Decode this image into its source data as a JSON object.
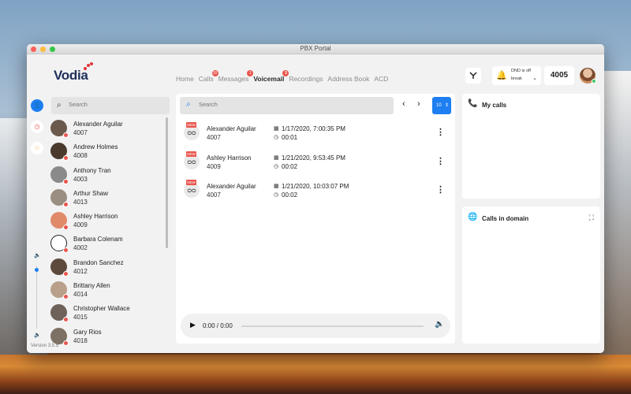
{
  "window": {
    "title": "PBX Portal"
  },
  "brand": {
    "logo_text": "Vodia",
    "logo_color": "#1f2e5a",
    "dot_color": "#e0353b"
  },
  "nav": {
    "items": [
      {
        "label": "Home",
        "badge": ""
      },
      {
        "label": "Calls",
        "badge": "10"
      },
      {
        "label": "Messages",
        "badge": "1"
      },
      {
        "label": "Voicemail",
        "badge": "3",
        "active": true
      },
      {
        "label": "Recordings",
        "badge": ""
      },
      {
        "label": "Address Book",
        "badge": ""
      },
      {
        "label": "ACD",
        "badge": ""
      }
    ]
  },
  "header": {
    "transfer_icon": "call-transfer-icon",
    "dnd_status": "DND is off",
    "dnd_option": "break",
    "extension": "4005",
    "bell_icon": "bell-icon"
  },
  "contacts": {
    "search_placeholder": "Search",
    "items": [
      {
        "name": "Alexander Aguilar",
        "ext": "4007"
      },
      {
        "name": "Andrew Holmes",
        "ext": "4008"
      },
      {
        "name": "Anthony Tran",
        "ext": "4003"
      },
      {
        "name": "Arthur Shaw",
        "ext": "4013"
      },
      {
        "name": "Ashley Harrison",
        "ext": "4009"
      },
      {
        "name": "Barbara Colenam",
        "ext": "4002"
      },
      {
        "name": "Brandon Sanchez",
        "ext": "4012"
      },
      {
        "name": "Brittany Allen",
        "ext": "4014"
      },
      {
        "name": "Christopher Wallace",
        "ext": "4015"
      },
      {
        "name": "Gary Rios",
        "ext": "4018"
      }
    ],
    "status_color": "#e8554d"
  },
  "version": "Version 3.5.5",
  "voicemail": {
    "search_placeholder": "Search",
    "page_size": "10",
    "new_label": "NEW",
    "items": [
      {
        "name": "Alexander Aguilar",
        "ext": "4007",
        "date": "1/17/2020, 7:00:35 PM",
        "duration": "00:01",
        "is_new": true
      },
      {
        "name": "Ashley Harrison",
        "ext": "4009",
        "date": "1/21/2020, 9:53:45 PM",
        "duration": "00:02",
        "is_new": true
      },
      {
        "name": "Alexander Aguilar",
        "ext": "4007",
        "date": "1/21/2020, 10:03:07 PM",
        "duration": "00:02",
        "is_new": true
      }
    ],
    "player": {
      "time": "0:00 / 0:00"
    }
  },
  "panels": {
    "my_calls_title": "My calls",
    "domain_calls_title": "Calls in domain"
  },
  "colors": {
    "accent": "#1d7ff0",
    "badge": "#e8554d",
    "online": "#3ec767"
  }
}
